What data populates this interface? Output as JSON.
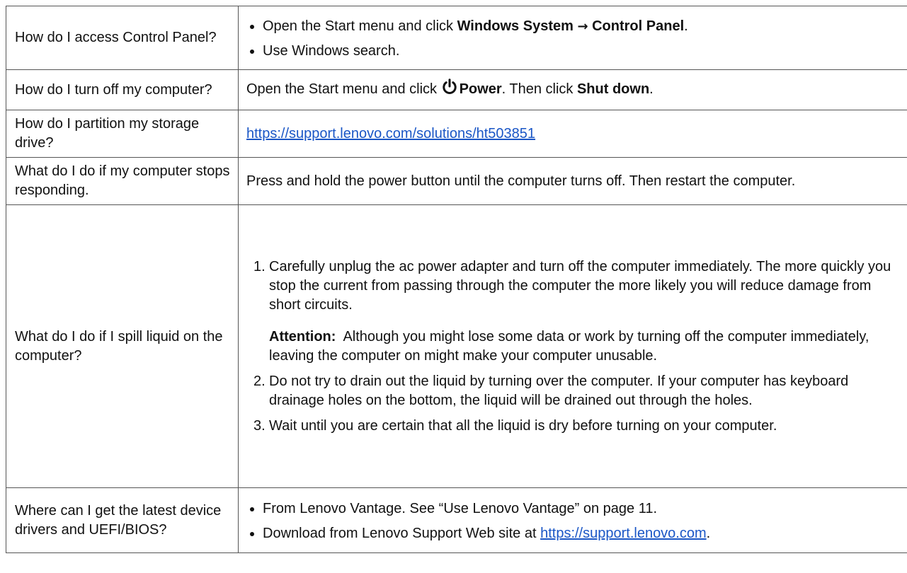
{
  "rows": [
    {
      "question": "How do I access Control Panel?",
      "bullets": [
        {
          "text": "Open the Start menu and click ",
          "bold1": "Windows System",
          "arrow": "→",
          "bold2": "Control Panel",
          "end": "."
        },
        {
          "text": "Use Windows search."
        }
      ]
    },
    {
      "question": "How do I turn off my computer?",
      "answer_pre": "Open the Start menu and click ",
      "answer_bold1": "Power",
      "answer_mid": ". Then click ",
      "answer_bold2": "Shut down",
      "answer_end": ".",
      "icon": "power-icon"
    },
    {
      "question": "How do I partition my storage drive?",
      "link": "https://support.lenovo.com/solutions/ht503851"
    },
    {
      "question": "What do I do if my computer stops responding.",
      "answer": "Press and hold the power button until the computer turns off. Then restart the computer."
    },
    {
      "question": "What do I do if I spill liquid on the computer?",
      "steps": [
        {
          "num": "1.",
          "text": "Carefully unplug the ac power adapter and turn off the computer immediately. The more quickly you stop the current from passing through the computer the more likely you will reduce damage from short circuits.",
          "attention_label": "Attention:",
          "attention_text": "Although you might lose some data or work by turning off the computer immediately, leaving the computer on might make your computer unusable."
        },
        {
          "num": "2.",
          "text": "Do not try to drain out the liquid by turning over the computer. If your computer has keyboard drainage holes on the bottom, the liquid will be drained out through the holes."
        },
        {
          "num": "3.",
          "text": "Wait until you are certain that all the liquid is dry before turning on your computer."
        }
      ]
    },
    {
      "question": "Where can I get the latest device drivers and UEFI/BIOS?",
      "bullets": [
        {
          "text": "From Lenovo Vantage. See “Use Lenovo Vantage” on page 11."
        },
        {
          "text": "Download from Lenovo Support Web site at ",
          "link": "https://support.lenovo.com",
          "end": "."
        }
      ]
    }
  ],
  "colors": {
    "border": "#555555",
    "link": "#1a56c6",
    "text": "#111111"
  }
}
